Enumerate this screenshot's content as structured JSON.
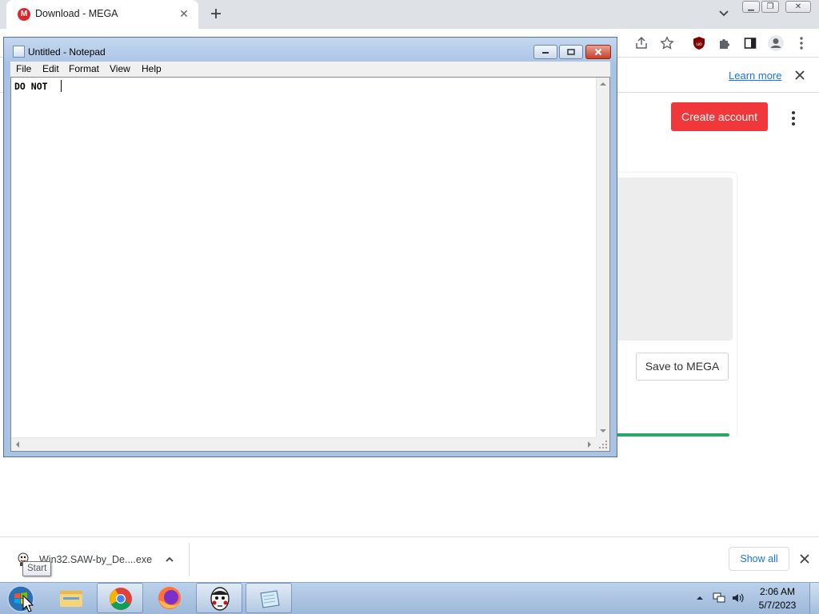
{
  "browser": {
    "tab_title": "Download - MEGA",
    "favicon_letter": "M",
    "icons": [
      "mega-logo-icon",
      "close-icon",
      "plus-icon",
      "chevron-down-icon",
      "share-icon",
      "star-icon",
      "ublock-icon",
      "puzzle-icon",
      "side-panel-icon",
      "profile-icon",
      "kebab-menu-icon"
    ],
    "infobar": {
      "learn_more": "Learn more"
    }
  },
  "mega_page": {
    "create_account": "Create account",
    "save_to_mega": "Save to MEGA",
    "progress_fraction": 1.0,
    "colors": {
      "create_account": "#f0373a",
      "progress": "#2ba56b"
    }
  },
  "notepad": {
    "title": "Untitled - Notepad",
    "menu": [
      "File",
      "Edit",
      "Format",
      "View",
      "Help"
    ],
    "content": "DO NOT "
  },
  "download_shelf": {
    "file_name": "Win32.SAW-by_De....exe",
    "show_all": "Show all"
  },
  "taskbar": {
    "tooltip": "Start",
    "apps": [
      "windows-explorer",
      "google-chrome",
      "firefox",
      "saw-app",
      "notepad"
    ],
    "clock_time": "2:06 AM",
    "clock_date": "5/7/2023"
  }
}
